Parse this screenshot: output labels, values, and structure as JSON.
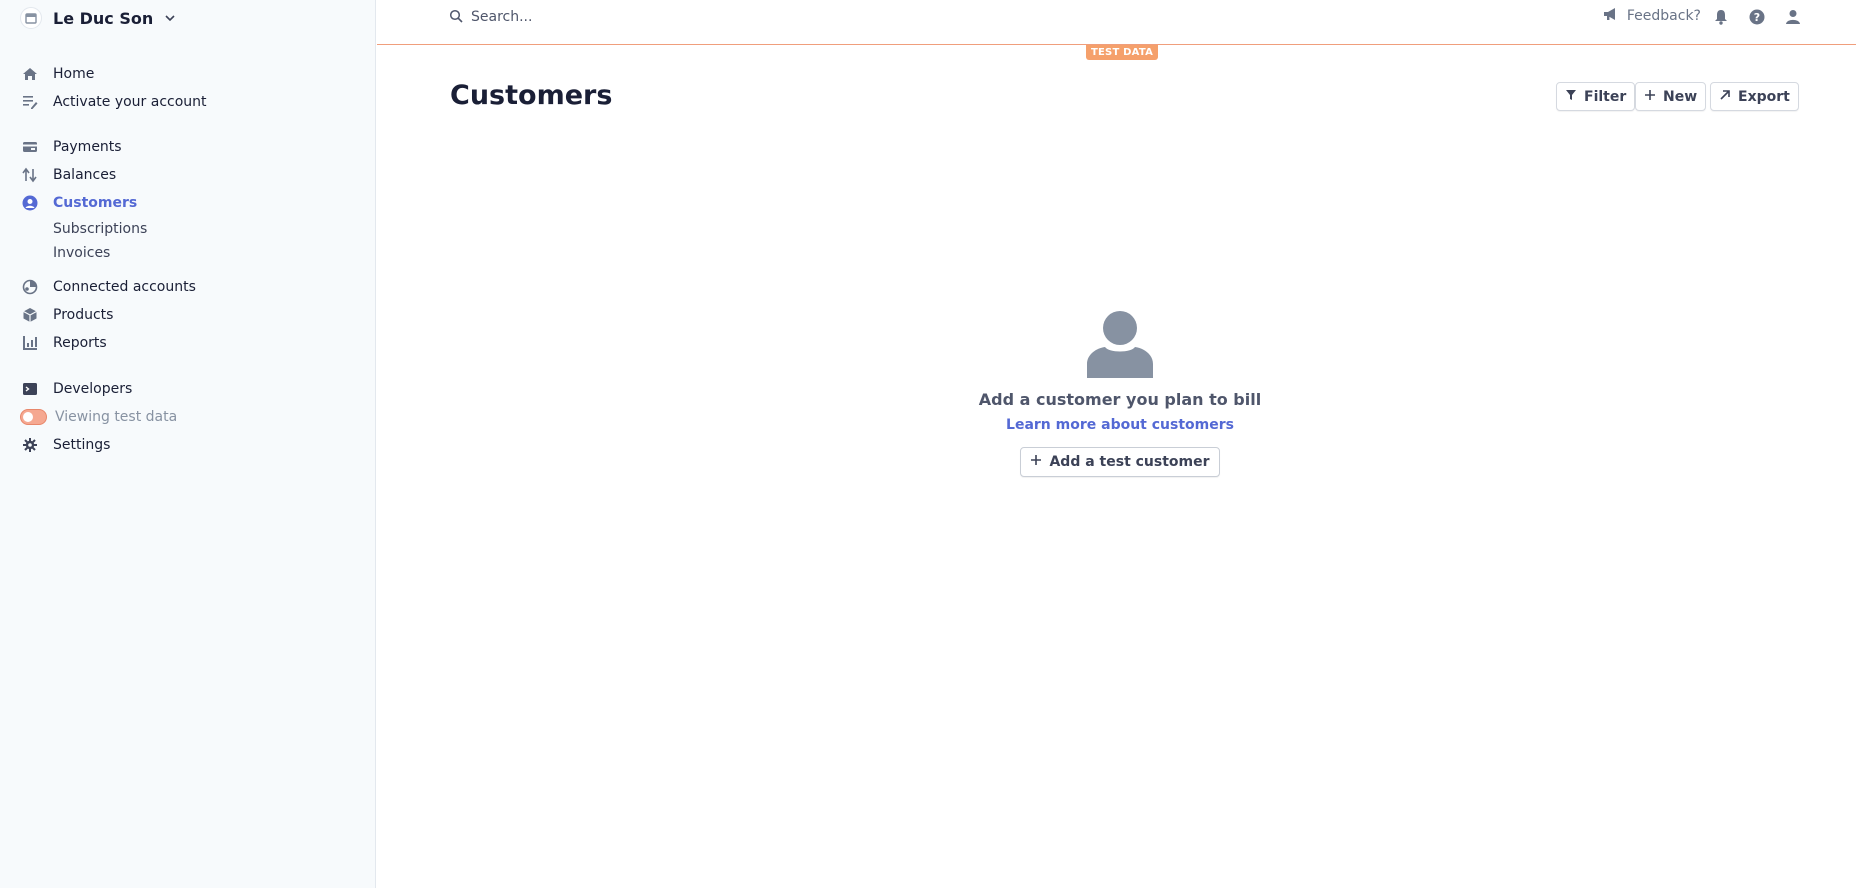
{
  "account": {
    "name": "Le Duc Son",
    "icon": "store-icon",
    "chevron": "chevron-down-icon"
  },
  "sidebar": {
    "items": [
      {
        "label": "Home",
        "icon": "home-icon"
      },
      {
        "label": "Activate your account",
        "icon": "activate-icon"
      },
      {
        "label": "Payments",
        "icon": "payments-icon"
      },
      {
        "label": "Balances",
        "icon": "balances-icon"
      },
      {
        "label": "Customers",
        "icon": "customers-icon",
        "active": true
      },
      {
        "label": "Connected accounts",
        "icon": "connected-icon"
      },
      {
        "label": "Products",
        "icon": "products-icon"
      },
      {
        "label": "Reports",
        "icon": "reports-icon"
      },
      {
        "label": "Developers",
        "icon": "developers-icon"
      },
      {
        "label": "Viewing test data",
        "icon": "toggle-icon"
      },
      {
        "label": "Settings",
        "icon": "gear-icon"
      }
    ],
    "sub_items": [
      "Subscriptions",
      "Invoices"
    ]
  },
  "topbar": {
    "search_placeholder": "Search...",
    "feedback": "Feedback?",
    "test_badge": "TEST DATA"
  },
  "main": {
    "title": "Customers",
    "buttons": {
      "filter": "Filter",
      "new": "New",
      "export": "Export"
    },
    "empty_state": {
      "message": "Add a customer you plan to bill",
      "link": "Learn more about customers",
      "button": "Add a test customer"
    }
  },
  "colors": {
    "accent": "#5469d4",
    "test_mode": "#f5a06b",
    "sidebar_bg": "#f7fafc",
    "icon_gray": "#697386"
  }
}
